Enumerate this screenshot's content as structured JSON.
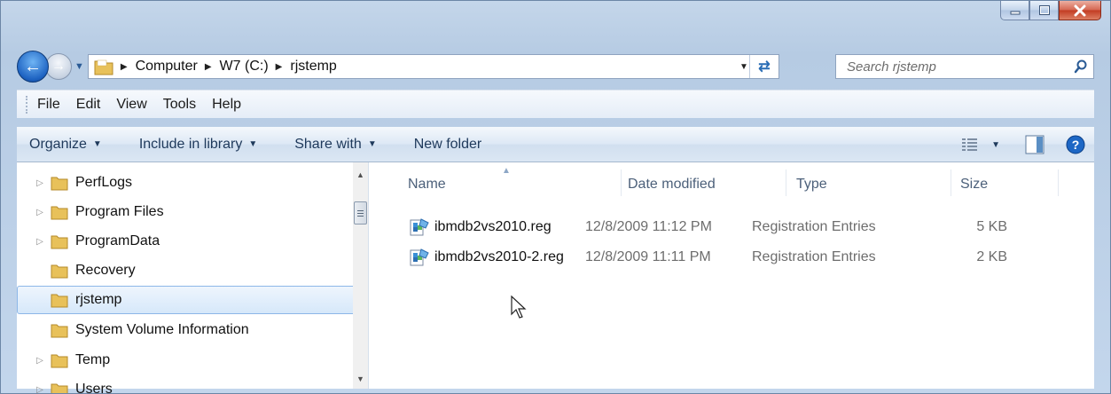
{
  "window": {
    "caption_buttons": [
      "minimize",
      "maximize",
      "close"
    ]
  },
  "address": {
    "crumbs": [
      "Computer",
      "W7 (C:)",
      "rjstemp"
    ]
  },
  "search": {
    "placeholder": "Search rjstemp"
  },
  "menu": {
    "items": [
      "File",
      "Edit",
      "View",
      "Tools",
      "Help"
    ]
  },
  "toolbar": {
    "organize": "Organize",
    "include": "Include in library",
    "share": "Share with",
    "new_folder": "New folder"
  },
  "tree": {
    "items": [
      {
        "label": "PerfLogs",
        "expandable": true
      },
      {
        "label": "Program Files",
        "expandable": true
      },
      {
        "label": "ProgramData",
        "expandable": true
      },
      {
        "label": "Recovery",
        "expandable": false
      },
      {
        "label": "rjstemp",
        "expandable": false,
        "selected": true
      },
      {
        "label": "System Volume Information",
        "expandable": false
      },
      {
        "label": "Temp",
        "expandable": true
      },
      {
        "label": "Users",
        "expandable": true
      }
    ]
  },
  "columns": {
    "name": "Name",
    "date": "Date modified",
    "type": "Type",
    "size": "Size"
  },
  "files": [
    {
      "name": "ibmdb2vs2010.reg",
      "date": "12/8/2009 11:12 PM",
      "type": "Registration Entries",
      "size": "5 KB"
    },
    {
      "name": "ibmdb2vs2010-2.reg",
      "date": "12/8/2009 11:11 PM",
      "type": "Registration Entries",
      "size": "2 KB"
    }
  ],
  "colors": {
    "close_red": "#c23b22",
    "folder_yellow": "#e8c15a",
    "selection_border": "#8db7e8"
  }
}
